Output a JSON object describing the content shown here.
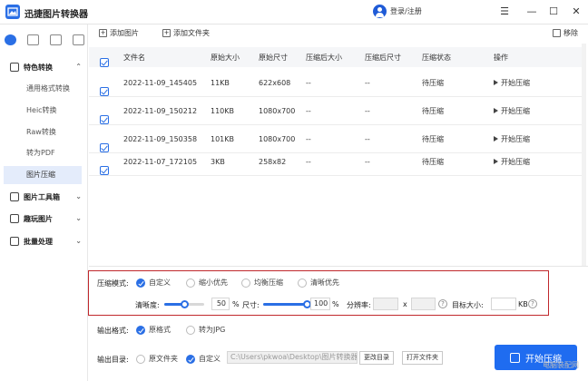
{
  "app": {
    "title": "迅捷图片转换器",
    "login": "登录/注册"
  },
  "window": {
    "menu": "☰",
    "minimize": "—",
    "maximize": "☐",
    "close": "✕"
  },
  "sidebar": {
    "groups": [
      {
        "label": "特色转换",
        "chev": "⌃"
      },
      {
        "label": "图片工具箱",
        "chev": "⌄"
      },
      {
        "label": "趣玩图片",
        "chev": "⌄"
      },
      {
        "label": "批量处理",
        "chev": "⌄"
      }
    ],
    "items": [
      "通用格式转换",
      "Heic转换",
      "Raw转换",
      "转为PDF",
      "图片压缩"
    ]
  },
  "toolbar": {
    "add_image": "添加图片",
    "add_folder": "添加文件夹",
    "remove": "移除"
  },
  "table": {
    "headers": [
      "文件名",
      "原始大小",
      "原始尺寸",
      "压缩后大小",
      "压缩后尺寸",
      "压缩状态",
      "操作"
    ],
    "rows": [
      {
        "name": "2022-11-09_145405",
        "size": "11KB",
        "dims": "622x608",
        "c_size": "--",
        "c_dims": "--",
        "status": "待压缩",
        "action": "开始压缩"
      },
      {
        "name": "2022-11-09_150212",
        "size": "110KB",
        "dims": "1080x700",
        "c_size": "--",
        "c_dims": "--",
        "status": "待压缩",
        "action": "开始压缩"
      },
      {
        "name": "2022-11-09_150358",
        "size": "101KB",
        "dims": "1080x700",
        "c_size": "--",
        "c_dims": "--",
        "status": "待压缩",
        "action": "开始压缩"
      },
      {
        "name": "2022-11-07_172105",
        "size": "3KB",
        "dims": "258x82",
        "c_size": "--",
        "c_dims": "--",
        "status": "待压缩",
        "action": "开始压缩"
      }
    ]
  },
  "compress": {
    "mode_label": "压缩模式:",
    "modes": [
      "自定义",
      "缩小优先",
      "均衡压缩",
      "清晰优先"
    ],
    "clarity_label": "清晰度:",
    "clarity_value": "50",
    "clarity_fraction": 0.5,
    "percent": "%",
    "size_label": "尺寸:",
    "size_value": "100",
    "size_fraction": 1.0,
    "resolution_label": "分辨率:",
    "res_w": "",
    "res_x": "x",
    "res_h": "",
    "target_label": "目标大小:",
    "target_value": "",
    "target_unit": "KB",
    "help": "?"
  },
  "output_format": {
    "label": "输出格式:",
    "options": [
      "原格式",
      "转为JPG"
    ]
  },
  "output_dir": {
    "label": "输出目录:",
    "options": [
      "原文件夹",
      "自定义"
    ],
    "path": "C:\\Users\\pkwoa\\Desktop\\图片转换器",
    "change_btn": "更改目录",
    "open_btn": "打开文件夹"
  },
  "start_button": "开始压缩",
  "watermark": "电脑装配网"
}
